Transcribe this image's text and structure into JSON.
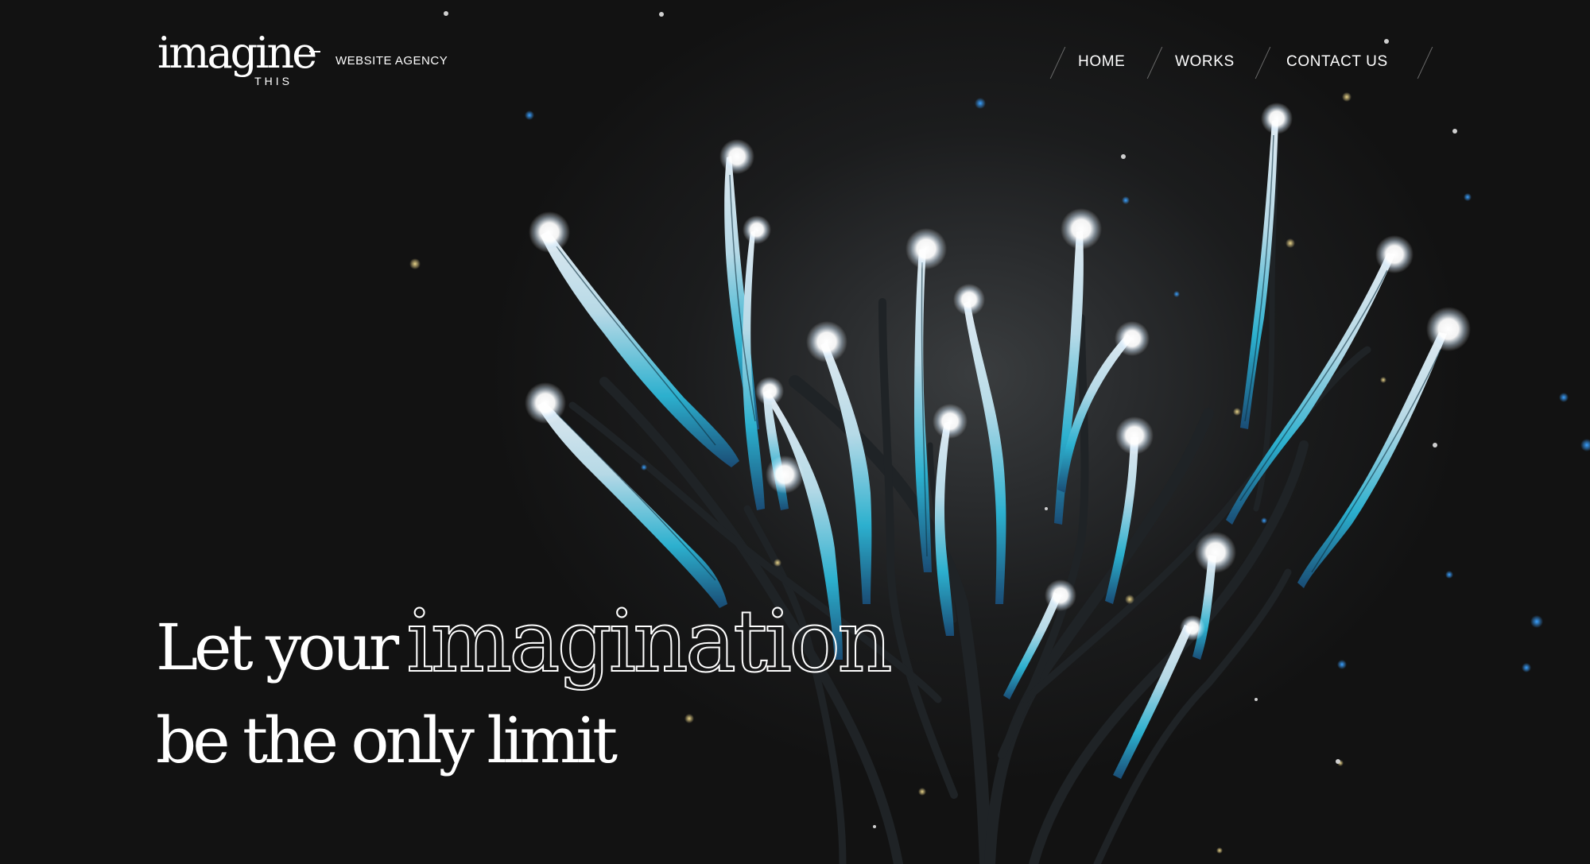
{
  "brand": {
    "logo_word": "imagine",
    "logo_sub": "THIS",
    "tagline": "WEBSITE AGENCY"
  },
  "nav": {
    "items": [
      {
        "label": "HOME"
      },
      {
        "label": "WORKS"
      },
      {
        "label": "CONTACT US"
      }
    ]
  },
  "hero": {
    "line1_prefix": "Let your",
    "line1_emphasis": "imagination",
    "line2": "be the only limit"
  },
  "colors": {
    "background": "#121212",
    "text": "#ffffff",
    "accent_cyan": "#22b3d6",
    "accent_blue": "#1f6fd1",
    "branch": "#1c2124"
  }
}
